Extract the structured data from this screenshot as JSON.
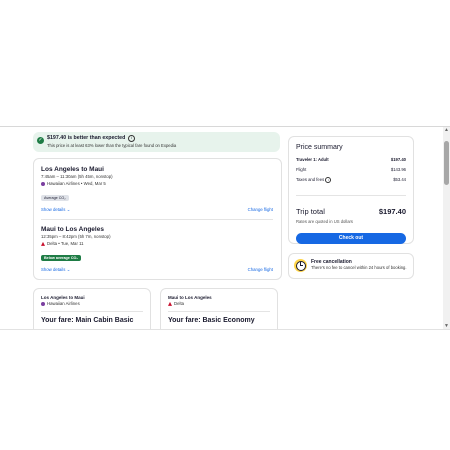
{
  "banner": {
    "title": "$197.40 is better than expected",
    "subtitle": "This price is at least 63% lower than the typical fare found on Expedia"
  },
  "legs": [
    {
      "route": "Los Angeles to Maui",
      "time": "7:45am – 11:30am (5h 45m, nonstop)",
      "airline": "Hawaiian Airlines • Wed, Mar 5",
      "badge": "Average CO₂",
      "show_details": "Show details",
      "change_flight": "Change flight"
    },
    {
      "route": "Maui to Los Angeles",
      "time": "12:35pm – 8:42pm (5h 7m, nonstop)",
      "airline": "Delta • Tue, Mar 11",
      "badge": "Below average CO₂",
      "show_details": "Show details",
      "change_flight": "Change flight"
    }
  ],
  "fares": [
    {
      "route": "Los Angeles to Maui",
      "airline": "Hawaiian Airlines",
      "name": "Your fare: Main Cabin Basic"
    },
    {
      "route": "Maui to Los Angeles",
      "airline": "Delta",
      "name": "Your fare: Basic Economy"
    }
  ],
  "price_summary": {
    "heading": "Price summary",
    "traveler_label": "Traveler 1: Adult",
    "traveler_value": "$197.40",
    "flight_label": "Flight",
    "flight_value": "$143.96",
    "taxes_label": "Taxes and fees",
    "taxes_value": "$53.44",
    "total_label": "Trip total",
    "total_value": "$197.40",
    "note": "Rates are quoted in US dollars",
    "button": "Check out"
  },
  "cancellation": {
    "title": "Free cancellation",
    "text": "There's no fee to cancel within 24 hours of booking."
  },
  "colors": {
    "accent": "#1668e3",
    "success": "#1e7c45",
    "banner_bg": "#e7f3ec"
  }
}
